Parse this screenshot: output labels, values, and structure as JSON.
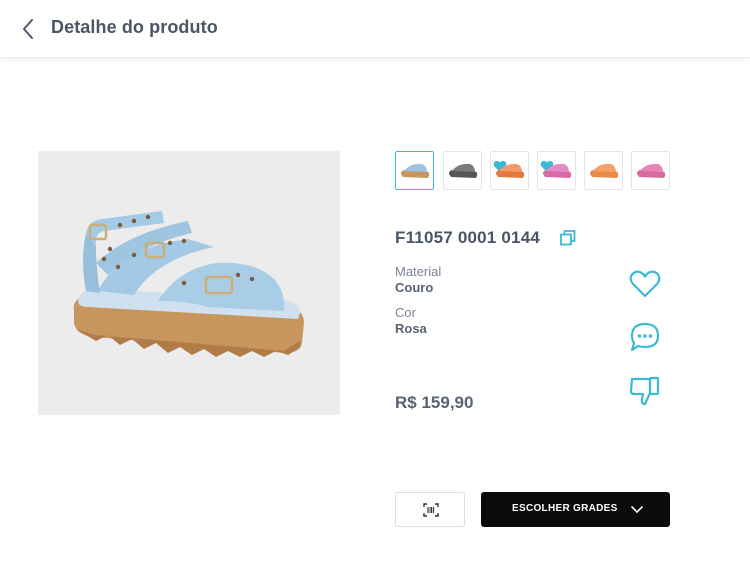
{
  "header": {
    "title": "Detalhe do produto",
    "back_icon": "chevron-left-icon"
  },
  "product": {
    "sku": "F11057 0001 0144",
    "material_label": "Material",
    "material_value": "Couro",
    "color_label": "Cor",
    "color_value": "Rosa",
    "price": "R$ 159,90"
  },
  "thumbnails": [
    {
      "color": "#9cc4e0",
      "selected": true,
      "favorite": false
    },
    {
      "color": "#7a7a7a",
      "selected": false,
      "favorite": false
    },
    {
      "color": "#f39a6a",
      "selected": false,
      "favorite": true
    },
    {
      "color": "#e58cc8",
      "selected": false,
      "favorite": true
    },
    {
      "color": "#f6a06a",
      "selected": false,
      "favorite": false
    },
    {
      "color": "#e884b6",
      "selected": false,
      "favorite": false
    }
  ],
  "actions": {
    "favorite_icon": "heart-icon",
    "comment_icon": "chat-bubble-icon",
    "dislike_icon": "thumbs-down-icon"
  },
  "buttons": {
    "scan_icon": "barcode-scan-icon",
    "grades_label": "ESCOLHER GRADES",
    "grades_icon": "chevron-down-icon"
  },
  "colors": {
    "accent": "#3cb9d6",
    "text": "#4b5567",
    "button_dark": "#0b0b0b"
  }
}
